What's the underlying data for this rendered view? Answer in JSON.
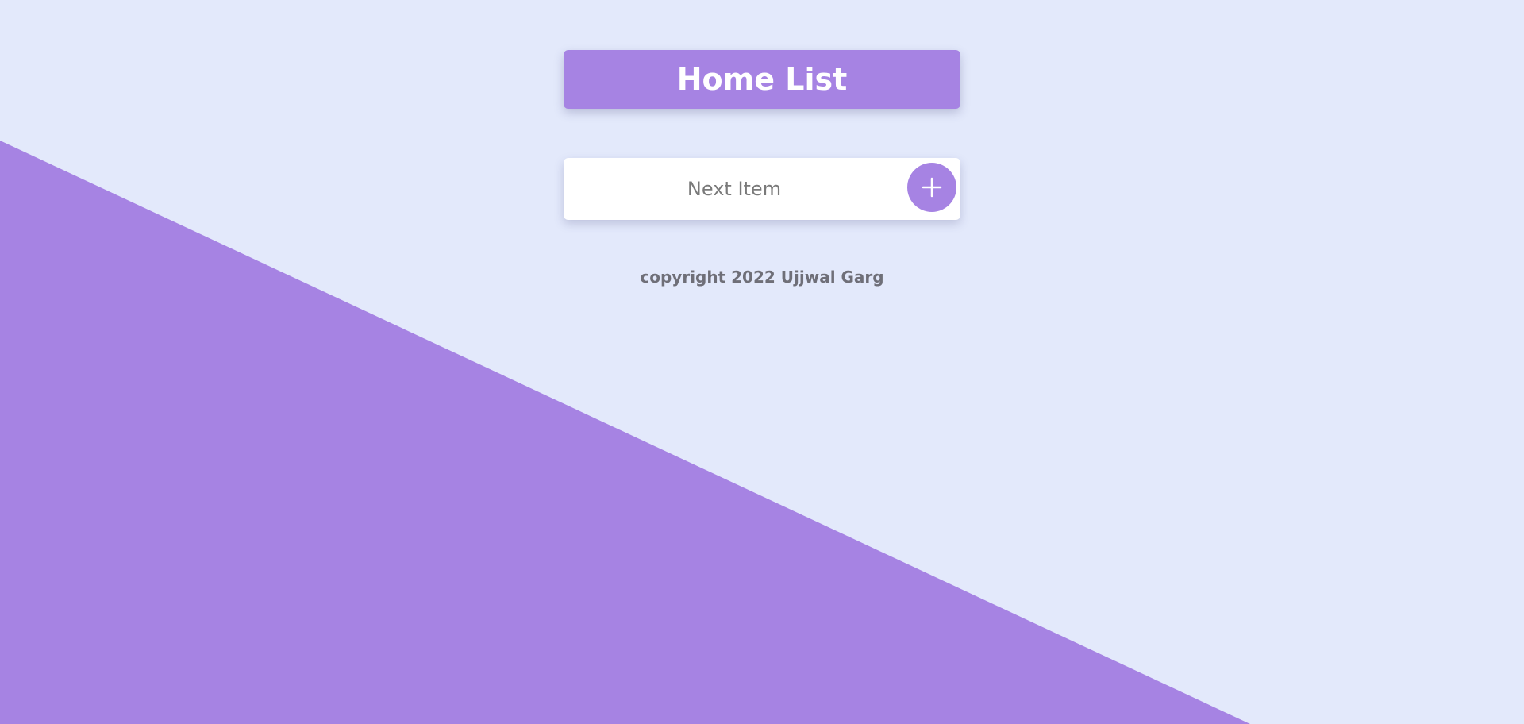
{
  "header": {
    "title": "Home List"
  },
  "form": {
    "input_placeholder": "Next Item",
    "add_button_icon": "plus-icon"
  },
  "footer": {
    "copyright": "copyright 2022 Ujjwal Garg"
  },
  "colors": {
    "background": "#e3e9fb",
    "accent": "#a683e3",
    "card": "#ffffff",
    "muted_text": "#6f6f78"
  }
}
